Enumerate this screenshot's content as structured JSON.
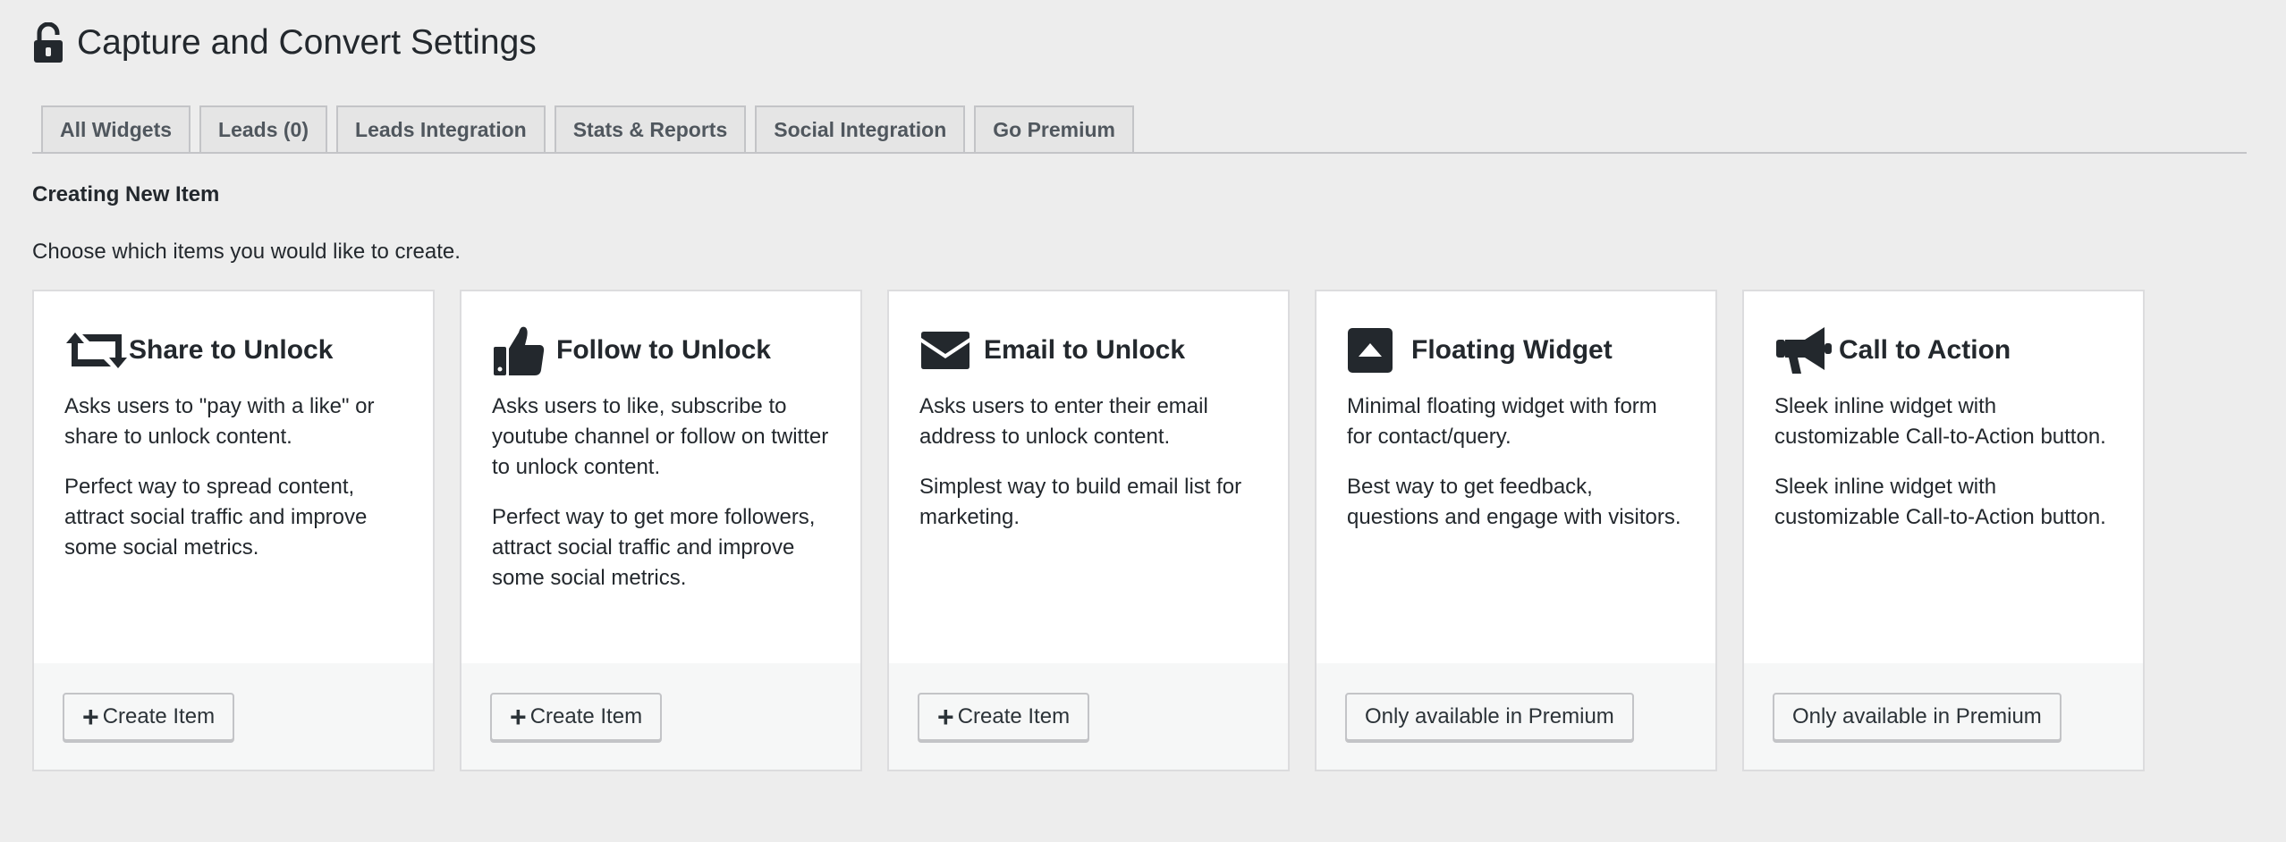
{
  "header": {
    "title": "Capture and Convert Settings",
    "icon": "unlocked-padlock-icon"
  },
  "tabs": [
    {
      "label": "All Widgets"
    },
    {
      "label": "Leads (0)"
    },
    {
      "label": "Leads Integration"
    },
    {
      "label": "Stats & Reports"
    },
    {
      "label": "Social Integration"
    },
    {
      "label": "Go Premium"
    }
  ],
  "section": {
    "title": "Creating New Item",
    "description": "Choose which items you would like to create."
  },
  "cards": [
    {
      "icon": "retweet-icon",
      "title": "Share to Unlock",
      "paragraph1": "Asks users to \"pay with a like\" or share to unlock content.",
      "paragraph2": "Perfect way to spread content, attract social traffic and improve some social metrics.",
      "button": "Create Item",
      "button_has_plus": true
    },
    {
      "icon": "thumbs-up-icon",
      "title": "Follow to Unlock",
      "paragraph1": "Asks users to like, subscribe to youtube channel or follow on twitter to unlock content.",
      "paragraph2": "Perfect way to get more followers, attract social traffic and improve some social metrics.",
      "button": "Create Item",
      "button_has_plus": true
    },
    {
      "icon": "envelope-icon",
      "title": "Email to Unlock",
      "paragraph1": "Asks users to enter their email address to unlock content.",
      "paragraph2": "Simplest way to build email list for marketing.",
      "button": "Create Item",
      "button_has_plus": true
    },
    {
      "icon": "caret-up-square-icon",
      "title": "Floating Widget",
      "paragraph1": "Minimal floating widget with form for contact/query.",
      "paragraph2": "Best way to get feedback, questions and engage with visitors.",
      "button": "Only available in Premium",
      "button_has_plus": false
    },
    {
      "icon": "megaphone-icon",
      "title": "Call to Action",
      "paragraph1": "Sleek inline widget with customizable Call-to-Action button.",
      "paragraph2": "Sleek inline widget with customizable Call-to-Action button.",
      "button": "Only available in Premium",
      "button_has_plus": false
    }
  ],
  "colors": {
    "background": "#ededed",
    "text": "#23282d",
    "card": "#ffffff",
    "card_footer": "#f6f7f7",
    "border": "#c3c4c7"
  }
}
